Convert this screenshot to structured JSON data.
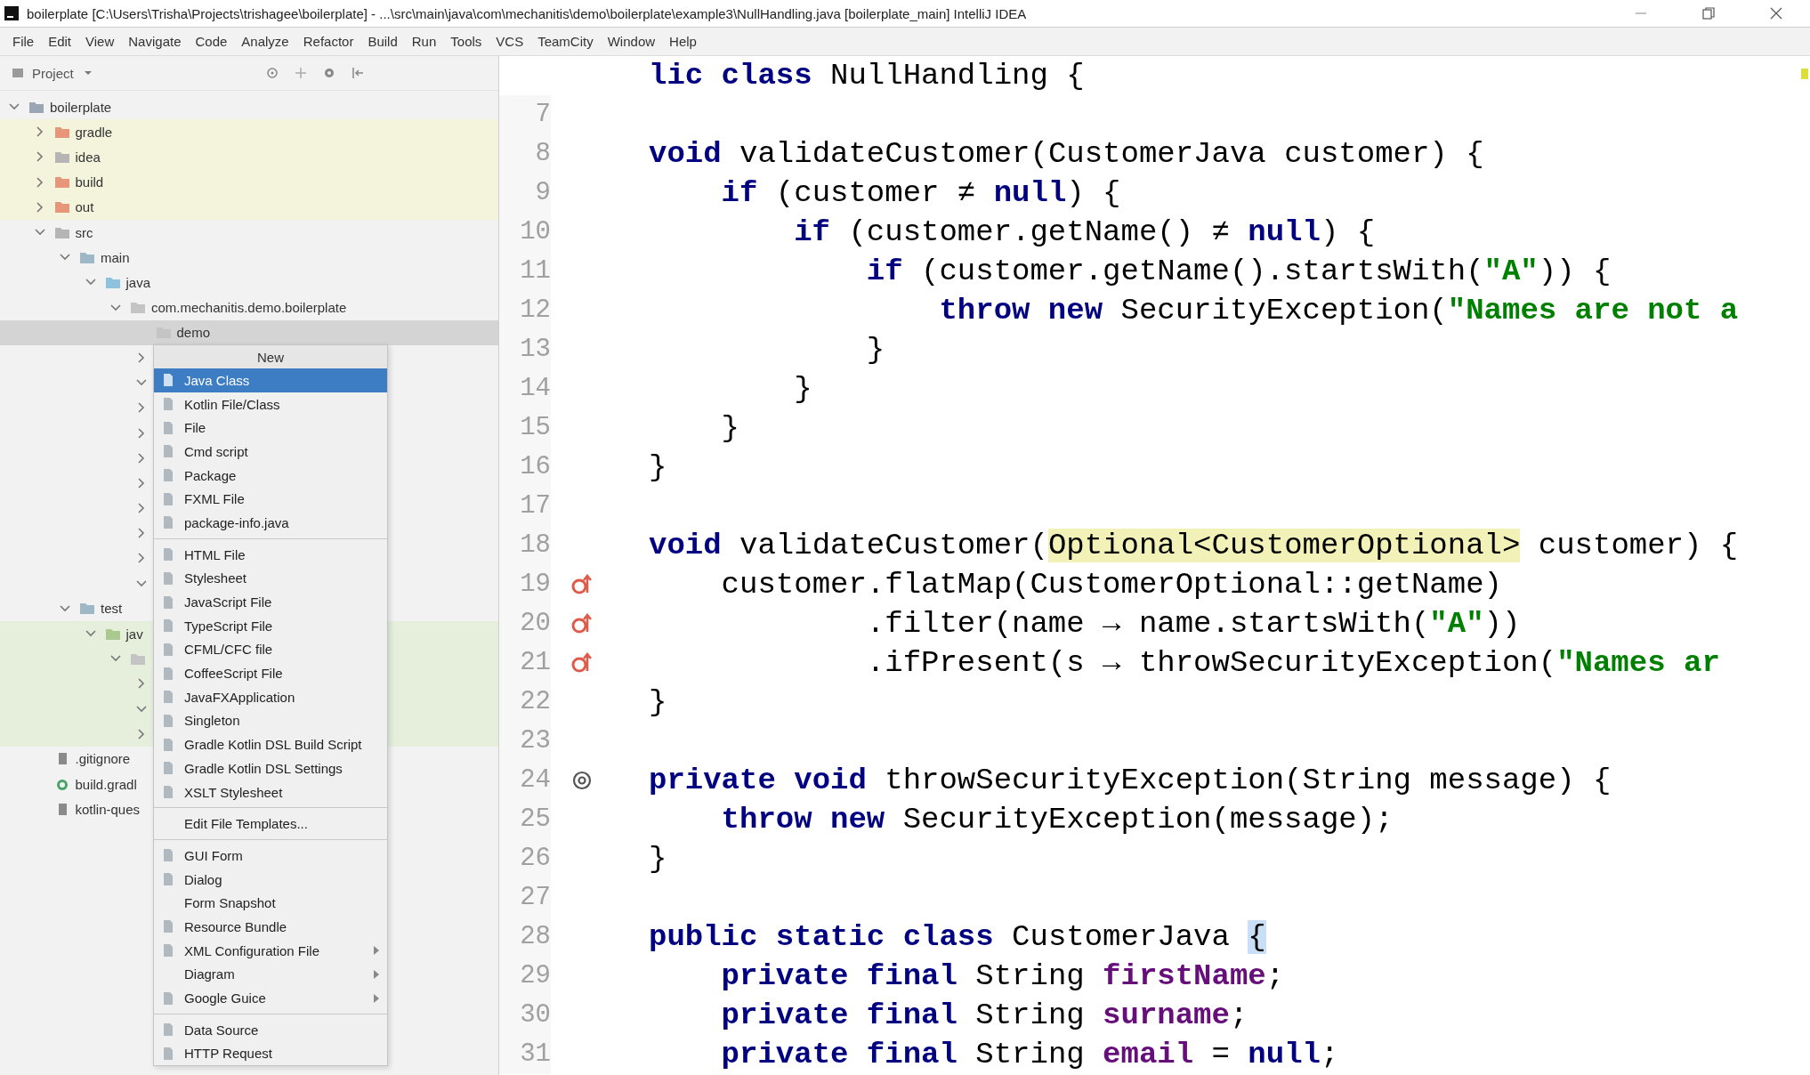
{
  "window": {
    "title": "boilerplate [C:\\Users\\Trisha\\Projects\\trishagee\\boilerplate] - ...\\src\\main\\java\\com\\mechanitis\\demo\\boilerplate\\example3\\NullHandling.java [boilerplate_main]   IntelliJ IDEA"
  },
  "menu": [
    "File",
    "Edit",
    "View",
    "Navigate",
    "Code",
    "Analyze",
    "Refactor",
    "Build",
    "Run",
    "Tools",
    "VCS",
    "TeamCity",
    "Window",
    "Help"
  ],
  "project_panel": {
    "title": "Project",
    "tree": [
      {
        "label": "boilerplate",
        "kind": "module",
        "expanded": true,
        "selected": false,
        "children": [
          {
            "label": "gradle",
            "kind": "excluded-folder",
            "excluded": true,
            "expanded": false,
            "selected": false
          },
          {
            "label": "idea",
            "kind": "folder",
            "excluded": true,
            "expanded": false,
            "selected": false
          },
          {
            "label": "build",
            "kind": "excluded-folder",
            "excluded": true,
            "expanded": false,
            "selected": false
          },
          {
            "label": "out",
            "kind": "excluded-folder",
            "excluded": true,
            "expanded": false,
            "selected": false
          },
          {
            "label": "src",
            "kind": "folder",
            "expanded": true,
            "selected": false,
            "children": [
              {
                "label": "main",
                "kind": "source-set",
                "expanded": true,
                "selected": false,
                "children": [
                  {
                    "label": "java",
                    "kind": "source-root",
                    "expanded": true,
                    "selected": false,
                    "children": [
                      {
                        "label": "com.mechanitis.demo.boilerplate",
                        "kind": "package",
                        "expanded": true,
                        "selected": false,
                        "children": [
                          {
                            "label": "demo",
                            "kind": "package",
                            "selected": true
                          },
                          {
                            "expanded": false,
                            "selected": false
                          },
                          {
                            "expanded": true,
                            "selected": false
                          },
                          {
                            "expanded": false,
                            "selected": false
                          },
                          {
                            "expanded": false,
                            "selected": false
                          },
                          {
                            "expanded": false,
                            "selected": false
                          },
                          {
                            "expanded": false,
                            "selected": false
                          },
                          {
                            "expanded": false,
                            "selected": false
                          },
                          {
                            "expanded": false,
                            "selected": false
                          },
                          {
                            "expanded": false,
                            "selected": false
                          },
                          {
                            "expanded": true,
                            "selected": false
                          }
                        ]
                      }
                    ]
                  }
                ]
              },
              {
                "label": "test",
                "kind": "source-set",
                "expanded": true,
                "selected": false,
                "children": [
                  {
                    "label": "jav",
                    "kind": "test-root",
                    "test": true,
                    "expanded": true,
                    "selected": false,
                    "children": [
                      {
                        "kind": "package",
                        "test": true,
                        "expanded": true,
                        "selected": false,
                        "children": [
                          {
                            "test": true,
                            "expanded": false,
                            "selected": false
                          },
                          {
                            "test": true,
                            "expanded": true,
                            "selected": false
                          },
                          {
                            "test": true,
                            "expanded": false,
                            "selected": false
                          }
                        ]
                      }
                    ]
                  }
                ]
              }
            ]
          },
          {
            "label": ".gitignore",
            "kind": "file",
            "selected": false
          },
          {
            "label": "build.gradl",
            "kind": "gradle-file",
            "selected": false
          },
          {
            "label": "kotlin-ques",
            "kind": "file",
            "selected": false
          }
        ]
      }
    ]
  },
  "context_menu": {
    "title": "New",
    "items": [
      {
        "kind": "item",
        "label": "Java Class",
        "icon": true,
        "submenu": false,
        "selected": true
      },
      {
        "kind": "item",
        "label": "Kotlin File/Class",
        "icon": true,
        "submenu": false,
        "selected": false
      },
      {
        "kind": "item",
        "label": "File",
        "icon": true,
        "submenu": false,
        "selected": false
      },
      {
        "kind": "item",
        "label": "Cmd script",
        "icon": true,
        "submenu": false,
        "selected": false
      },
      {
        "kind": "item",
        "label": "Package",
        "icon": true,
        "submenu": false,
        "selected": false
      },
      {
        "kind": "item",
        "label": "FXML File",
        "icon": true,
        "submenu": false,
        "selected": false
      },
      {
        "kind": "item",
        "label": "package-info.java",
        "icon": true,
        "submenu": false,
        "selected": false
      },
      {
        "kind": "separator"
      },
      {
        "kind": "item",
        "label": "HTML File",
        "icon": true,
        "submenu": false,
        "selected": false
      },
      {
        "kind": "item",
        "label": "Stylesheet",
        "icon": true,
        "submenu": false,
        "selected": false
      },
      {
        "kind": "item",
        "label": "JavaScript File",
        "icon": true,
        "submenu": false,
        "selected": false
      },
      {
        "kind": "item",
        "label": "TypeScript File",
        "icon": true,
        "submenu": false,
        "selected": false
      },
      {
        "kind": "item",
        "label": "CFML/CFC file",
        "icon": true,
        "submenu": false,
        "selected": false
      },
      {
        "kind": "item",
        "label": "CoffeeScript File",
        "icon": true,
        "submenu": false,
        "selected": false
      },
      {
        "kind": "item",
        "label": "JavaFXApplication",
        "icon": true,
        "submenu": false,
        "selected": false
      },
      {
        "kind": "item",
        "label": "Singleton",
        "icon": true,
        "submenu": false,
        "selected": false
      },
      {
        "kind": "item",
        "label": "Gradle Kotlin DSL Build Script",
        "icon": true,
        "submenu": false,
        "selected": false
      },
      {
        "kind": "item",
        "label": "Gradle Kotlin DSL Settings",
        "icon": true,
        "submenu": false,
        "selected": false
      },
      {
        "kind": "item",
        "label": "XSLT Stylesheet",
        "icon": true,
        "submenu": false,
        "selected": false
      },
      {
        "kind": "separator"
      },
      {
        "kind": "item",
        "label": "Edit File Templates...",
        "icon": false,
        "submenu": false,
        "selected": false
      },
      {
        "kind": "separator"
      },
      {
        "kind": "item",
        "label": "GUI Form",
        "icon": true,
        "submenu": false,
        "selected": false
      },
      {
        "kind": "item",
        "label": "Dialog",
        "icon": true,
        "submenu": false,
        "selected": false
      },
      {
        "kind": "item",
        "label": "Form Snapshot",
        "icon": false,
        "submenu": false,
        "selected": false
      },
      {
        "kind": "item",
        "label": "Resource Bundle",
        "icon": true,
        "submenu": false,
        "selected": false
      },
      {
        "kind": "item",
        "label": "XML Configuration File",
        "icon": true,
        "submenu": true,
        "selected": false
      },
      {
        "kind": "item",
        "label": "Diagram",
        "icon": false,
        "submenu": true,
        "selected": false
      },
      {
        "kind": "item",
        "label": "Google Guice",
        "icon": true,
        "submenu": true,
        "selected": false
      },
      {
        "kind": "separator"
      },
      {
        "kind": "item",
        "label": "Data Source",
        "icon": true,
        "submenu": false,
        "selected": false
      },
      {
        "kind": "item",
        "label": "HTTP Request",
        "icon": true,
        "submenu": false,
        "selected": false
      }
    ]
  },
  "editor": {
    "lines": [
      {
        "kind": "code",
        "tokens": [
          {
            "kind": "kw",
            "text": "lic class"
          },
          {
            "kind": "plain",
            "text": " NullHandling {"
          }
        ]
      },
      {
        "kind": "code",
        "number": "7"
      },
      {
        "kind": "code",
        "number": "8",
        "tokens": [
          {
            "kind": "kw",
            "text": "void"
          },
          {
            "kind": "plain",
            "text": " validateCustomer(CustomerJava customer) {"
          }
        ]
      },
      {
        "kind": "code",
        "number": "9",
        "tokens": [
          {
            "kind": "kw",
            "text": "    if"
          },
          {
            "kind": "plain",
            "text": " (customer ≠ "
          },
          {
            "kind": "kw",
            "text": "null"
          },
          {
            "kind": "plain",
            "text": ") {"
          }
        ]
      },
      {
        "kind": "code",
        "number": "10",
        "tokens": [
          {
            "kind": "kw",
            "text": "        if"
          },
          {
            "kind": "plain",
            "text": " (customer.getName() ≠ "
          },
          {
            "kind": "kw",
            "text": "null"
          },
          {
            "kind": "plain",
            "text": ") {"
          }
        ]
      },
      {
        "kind": "code",
        "number": "11",
        "tokens": [
          {
            "kind": "kw",
            "text": "            if"
          },
          {
            "kind": "plain",
            "text": " (customer.getName().startsWith("
          },
          {
            "kind": "str",
            "text": "\"A\""
          },
          {
            "kind": "plain",
            "text": ")) {"
          }
        ]
      },
      {
        "kind": "code",
        "number": "12",
        "tokens": [
          {
            "kind": "kw",
            "text": "                throw new"
          },
          {
            "kind": "plain",
            "text": " SecurityException("
          },
          {
            "kind": "str",
            "text": "\"Names are not a"
          }
        ]
      },
      {
        "kind": "code",
        "number": "13",
        "tokens": [
          {
            "kind": "plain",
            "text": "            }"
          }
        ]
      },
      {
        "kind": "code",
        "number": "14",
        "tokens": [
          {
            "kind": "plain",
            "text": "        }"
          }
        ]
      },
      {
        "kind": "code",
        "number": "15",
        "tokens": [
          {
            "kind": "plain",
            "text": "    }"
          }
        ]
      },
      {
        "kind": "code",
        "number": "16",
        "tokens": [
          {
            "kind": "plain",
            "text": "}"
          }
        ]
      },
      {
        "kind": "code",
        "number": "17"
      },
      {
        "kind": "code",
        "number": "18",
        "tokens": [
          {
            "kind": "kw",
            "text": "void"
          },
          {
            "kind": "plain",
            "text": " validateCustomer("
          },
          {
            "kind": "match",
            "text": "Optional<CustomerOptional>"
          },
          {
            "kind": "plain",
            "text": " customer) {"
          }
        ]
      },
      {
        "kind": "lambda",
        "number": "19",
        "tokens": [
          {
            "kind": "plain",
            "text": "    customer.flatMap(CustomerOptional::getName)"
          }
        ]
      },
      {
        "kind": "lambda",
        "number": "20",
        "tokens": [
          {
            "kind": "plain",
            "text": "            .filter(name → name.startsWith("
          },
          {
            "kind": "str",
            "text": "\"A\""
          },
          {
            "kind": "plain",
            "text": "))"
          }
        ]
      },
      {
        "kind": "lambda",
        "number": "21",
        "tokens": [
          {
            "kind": "plain",
            "text": "            .ifPresent(s → throwSecurityException("
          },
          {
            "kind": "str",
            "text": "\"Names ar"
          }
        ]
      },
      {
        "kind": "code",
        "number": "22",
        "tokens": [
          {
            "kind": "plain",
            "text": "}"
          }
        ]
      },
      {
        "kind": "code",
        "number": "23"
      },
      {
        "kind": "usage",
        "number": "24",
        "tokens": [
          {
            "kind": "kw",
            "text": "private void"
          },
          {
            "kind": "plain",
            "text": " throwSecurityException(String message) {"
          }
        ]
      },
      {
        "kind": "code",
        "number": "25",
        "tokens": [
          {
            "kind": "kw",
            "text": "    throw new"
          },
          {
            "kind": "plain",
            "text": " SecurityException(message);"
          }
        ]
      },
      {
        "kind": "code",
        "number": "26",
        "tokens": [
          {
            "kind": "plain",
            "text": "}"
          }
        ]
      },
      {
        "kind": "code",
        "number": "27"
      },
      {
        "kind": "code",
        "number": "28",
        "tokens": [
          {
            "kind": "kw",
            "text": "public static class"
          },
          {
            "kind": "plain",
            "text": " CustomerJava "
          },
          {
            "kind": "brace",
            "text": "{"
          }
        ]
      },
      {
        "kind": "code",
        "number": "29",
        "tokens": [
          {
            "kind": "kw",
            "text": "    private final"
          },
          {
            "kind": "plain",
            "text": " String "
          },
          {
            "kind": "field",
            "text": "firstName"
          },
          {
            "kind": "plain",
            "text": ";"
          }
        ]
      },
      {
        "kind": "code",
        "number": "30",
        "tokens": [
          {
            "kind": "kw",
            "text": "    private final"
          },
          {
            "kind": "plain",
            "text": " String "
          },
          {
            "kind": "field",
            "text": "surname"
          },
          {
            "kind": "plain",
            "text": ";"
          }
        ]
      },
      {
        "kind": "code",
        "number": "31",
        "tokens": [
          {
            "kind": "kw",
            "text": "    private final"
          },
          {
            "kind": "plain",
            "text": " String "
          },
          {
            "kind": "field",
            "text": "email"
          },
          {
            "kind": "plain",
            "text": " = "
          },
          {
            "kind": "kw",
            "text": "null"
          },
          {
            "kind": "plain",
            "text": ";"
          }
        ]
      }
    ]
  }
}
